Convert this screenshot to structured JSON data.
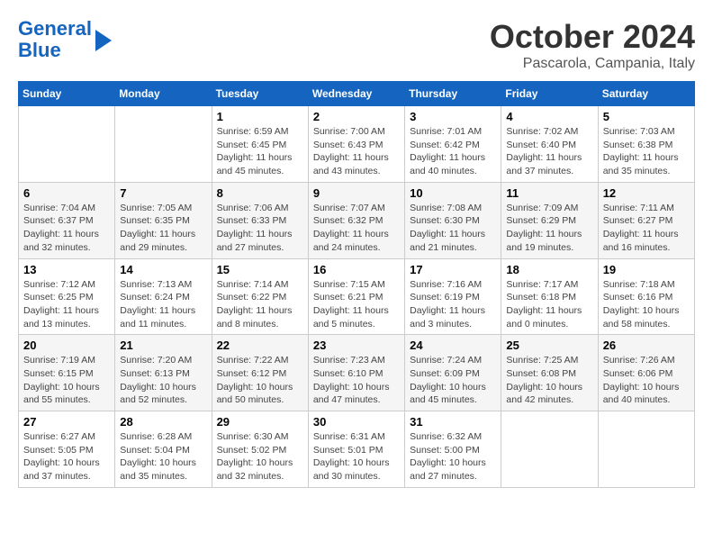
{
  "header": {
    "logo_line1": "General",
    "logo_line2": "Blue",
    "month_title": "October 2024",
    "subtitle": "Pascarola, Campania, Italy"
  },
  "days_of_week": [
    "Sunday",
    "Monday",
    "Tuesday",
    "Wednesday",
    "Thursday",
    "Friday",
    "Saturday"
  ],
  "weeks": [
    [
      {
        "day": "",
        "info": ""
      },
      {
        "day": "",
        "info": ""
      },
      {
        "day": "1",
        "info": "Sunrise: 6:59 AM\nSunset: 6:45 PM\nDaylight: 11 hours and 45 minutes."
      },
      {
        "day": "2",
        "info": "Sunrise: 7:00 AM\nSunset: 6:43 PM\nDaylight: 11 hours and 43 minutes."
      },
      {
        "day": "3",
        "info": "Sunrise: 7:01 AM\nSunset: 6:42 PM\nDaylight: 11 hours and 40 minutes."
      },
      {
        "day": "4",
        "info": "Sunrise: 7:02 AM\nSunset: 6:40 PM\nDaylight: 11 hours and 37 minutes."
      },
      {
        "day": "5",
        "info": "Sunrise: 7:03 AM\nSunset: 6:38 PM\nDaylight: 11 hours and 35 minutes."
      }
    ],
    [
      {
        "day": "6",
        "info": "Sunrise: 7:04 AM\nSunset: 6:37 PM\nDaylight: 11 hours and 32 minutes."
      },
      {
        "day": "7",
        "info": "Sunrise: 7:05 AM\nSunset: 6:35 PM\nDaylight: 11 hours and 29 minutes."
      },
      {
        "day": "8",
        "info": "Sunrise: 7:06 AM\nSunset: 6:33 PM\nDaylight: 11 hours and 27 minutes."
      },
      {
        "day": "9",
        "info": "Sunrise: 7:07 AM\nSunset: 6:32 PM\nDaylight: 11 hours and 24 minutes."
      },
      {
        "day": "10",
        "info": "Sunrise: 7:08 AM\nSunset: 6:30 PM\nDaylight: 11 hours and 21 minutes."
      },
      {
        "day": "11",
        "info": "Sunrise: 7:09 AM\nSunset: 6:29 PM\nDaylight: 11 hours and 19 minutes."
      },
      {
        "day": "12",
        "info": "Sunrise: 7:11 AM\nSunset: 6:27 PM\nDaylight: 11 hours and 16 minutes."
      }
    ],
    [
      {
        "day": "13",
        "info": "Sunrise: 7:12 AM\nSunset: 6:25 PM\nDaylight: 11 hours and 13 minutes."
      },
      {
        "day": "14",
        "info": "Sunrise: 7:13 AM\nSunset: 6:24 PM\nDaylight: 11 hours and 11 minutes."
      },
      {
        "day": "15",
        "info": "Sunrise: 7:14 AM\nSunset: 6:22 PM\nDaylight: 11 hours and 8 minutes."
      },
      {
        "day": "16",
        "info": "Sunrise: 7:15 AM\nSunset: 6:21 PM\nDaylight: 11 hours and 5 minutes."
      },
      {
        "day": "17",
        "info": "Sunrise: 7:16 AM\nSunset: 6:19 PM\nDaylight: 11 hours and 3 minutes."
      },
      {
        "day": "18",
        "info": "Sunrise: 7:17 AM\nSunset: 6:18 PM\nDaylight: 11 hours and 0 minutes."
      },
      {
        "day": "19",
        "info": "Sunrise: 7:18 AM\nSunset: 6:16 PM\nDaylight: 10 hours and 58 minutes."
      }
    ],
    [
      {
        "day": "20",
        "info": "Sunrise: 7:19 AM\nSunset: 6:15 PM\nDaylight: 10 hours and 55 minutes."
      },
      {
        "day": "21",
        "info": "Sunrise: 7:20 AM\nSunset: 6:13 PM\nDaylight: 10 hours and 52 minutes."
      },
      {
        "day": "22",
        "info": "Sunrise: 7:22 AM\nSunset: 6:12 PM\nDaylight: 10 hours and 50 minutes."
      },
      {
        "day": "23",
        "info": "Sunrise: 7:23 AM\nSunset: 6:10 PM\nDaylight: 10 hours and 47 minutes."
      },
      {
        "day": "24",
        "info": "Sunrise: 7:24 AM\nSunset: 6:09 PM\nDaylight: 10 hours and 45 minutes."
      },
      {
        "day": "25",
        "info": "Sunrise: 7:25 AM\nSunset: 6:08 PM\nDaylight: 10 hours and 42 minutes."
      },
      {
        "day": "26",
        "info": "Sunrise: 7:26 AM\nSunset: 6:06 PM\nDaylight: 10 hours and 40 minutes."
      }
    ],
    [
      {
        "day": "27",
        "info": "Sunrise: 6:27 AM\nSunset: 5:05 PM\nDaylight: 10 hours and 37 minutes."
      },
      {
        "day": "28",
        "info": "Sunrise: 6:28 AM\nSunset: 5:04 PM\nDaylight: 10 hours and 35 minutes."
      },
      {
        "day": "29",
        "info": "Sunrise: 6:30 AM\nSunset: 5:02 PM\nDaylight: 10 hours and 32 minutes."
      },
      {
        "day": "30",
        "info": "Sunrise: 6:31 AM\nSunset: 5:01 PM\nDaylight: 10 hours and 30 minutes."
      },
      {
        "day": "31",
        "info": "Sunrise: 6:32 AM\nSunset: 5:00 PM\nDaylight: 10 hours and 27 minutes."
      },
      {
        "day": "",
        "info": ""
      },
      {
        "day": "",
        "info": ""
      }
    ]
  ]
}
